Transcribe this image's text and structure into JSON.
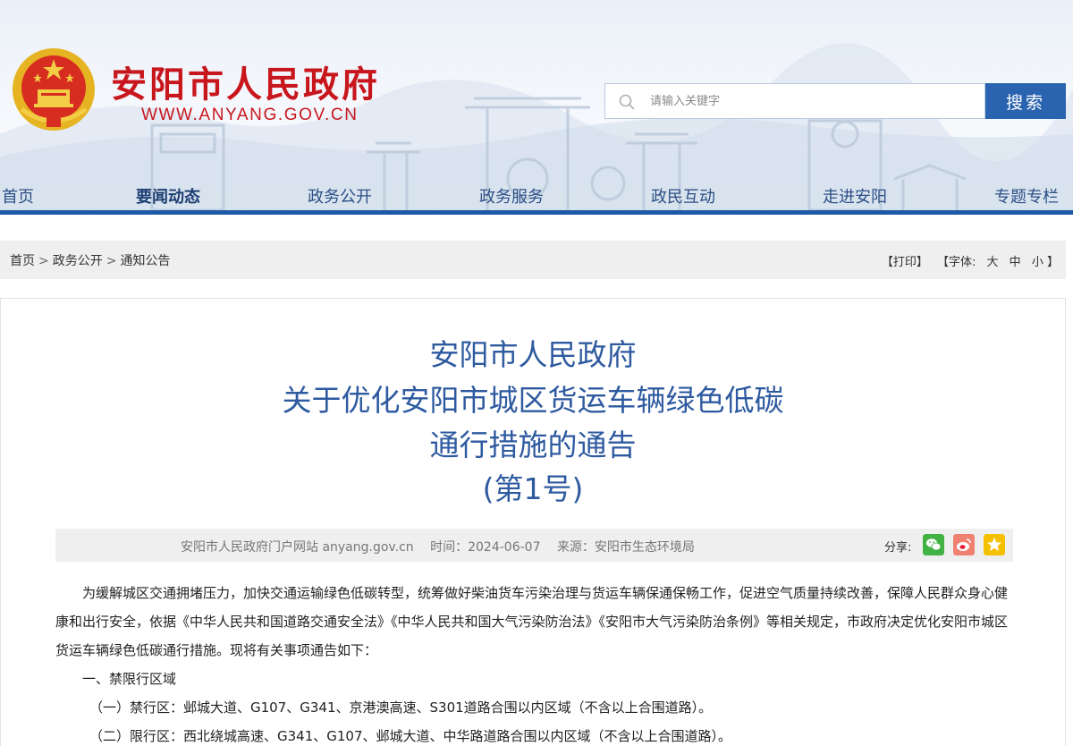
{
  "header": {
    "site_name": "安阳市人民政府",
    "site_url": "WWW.ANYANG.GOV.CN",
    "search": {
      "placeholder": "请输入关键字",
      "button_label": "搜索"
    },
    "nav": [
      "首页",
      "要闻动态",
      "政务公开",
      "政务服务",
      "政民互动",
      "走进安阳",
      "专题专栏"
    ],
    "active_nav": "要闻动态"
  },
  "breadcrumb": {
    "items": [
      "首页",
      "政务公开",
      "通知公告"
    ],
    "separator": ">"
  },
  "tools": {
    "print": "【打印】",
    "font_label": "【字体:",
    "large": "大",
    "medium": "中",
    "small": "小",
    "close": "】"
  },
  "article": {
    "title_lines": [
      "安阳市人民政府",
      "关于优化安阳市城区货运车辆绿色低碳",
      "通行措施的通告",
      "(第1号)"
    ],
    "meta": {
      "site": "安阳市人民政府门户网站 anyang.gov.cn",
      "time": "时间：2024-06-07",
      "source": "来源：安阳市生态环境局"
    },
    "share_label": "分享:",
    "share_icons": [
      "wechat-icon",
      "weibo-icon",
      "favorite-star-icon"
    ],
    "paragraph": "为缓解城区交通拥堵压力，加快交通运输绿色低碳转型，统筹做好柴油货车污染治理与货运车辆保通保畅工作，促进空气质量持续改善，保障人民群众身心健康和出行安全，依据《中华人民共和国道路交通安全法》《中华人民共和国大气污染防治法》《安阳市大气污染防治条例》等相关规定，市政府决定优化安阳市城区货运车辆绿色低碳通行措施。现将有关事项通告如下：",
    "section_heading": "一、禁限行区域",
    "items": [
      "（一）禁行区：邺城大道、G107、G341、京港澳高速、S301道路合围以内区域（不含以上合围道路）。",
      "（二）限行区：西北绕城高速、G341、G107、邺城大道、中华路道路合围以内区域（不含以上合围道路）。"
    ]
  },
  "colors": {
    "brand_red": "#c8161d",
    "nav_blue": "#1c5aa8",
    "title_blue": "#2e5aa0",
    "search_button": "#2a63b0"
  }
}
